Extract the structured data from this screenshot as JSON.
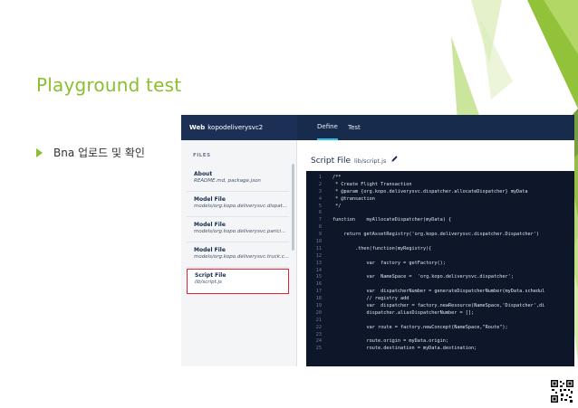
{
  "slide": {
    "title": "Playground test",
    "bullet": "Bna 업로드 및 확인"
  },
  "app": {
    "brand": "Web",
    "network": "kopodeliverysvc2",
    "tabs": [
      {
        "label": "Define",
        "active": true
      },
      {
        "label": "Test",
        "active": false
      }
    ],
    "sidebar": {
      "heading": "FILES",
      "items": [
        {
          "name": "About",
          "path": "README.md, package.json",
          "selected": false
        },
        {
          "name": "Model File",
          "path": "models/org.kopo.deliverysvc.dispat...",
          "selected": false
        },
        {
          "name": "Model File",
          "path": "models/org.kopo.deliverysvc.parici...",
          "selected": false
        },
        {
          "name": "Model File",
          "path": "models/org.kopo.deliverysvc.truck.c...",
          "selected": false
        },
        {
          "name": "Script File",
          "path": "lib/script.js",
          "selected": true
        }
      ]
    },
    "editor": {
      "label": "Script File",
      "path": "lib/script.js",
      "lines": [
        {
          "n": "1",
          "text": "/**",
          "cls": "tok-comment"
        },
        {
          "n": "2",
          "text": " * Create Flight Transaction",
          "cls": "tok-comment"
        },
        {
          "n": "3",
          "text": " * @param {org.kopo.deliverysvc.dispatcher.allocateDispatcher} myData",
          "cls": "tok-comment"
        },
        {
          "n": "4",
          "text": " * @transaction",
          "cls": "tok-comment"
        },
        {
          "n": "5",
          "text": " */",
          "cls": "tok-comment"
        },
        {
          "n": "6",
          "text": "",
          "cls": ""
        },
        {
          "n": "7",
          "text": "function    myAllocateDispatcher(myData) {",
          "cls": ""
        },
        {
          "n": "8",
          "text": "",
          "cls": ""
        },
        {
          "n": "9",
          "text": "    return getAssetRegistry('org.kopo.deliverysvc.dispatcher.Dispatcher')",
          "cls": ""
        },
        {
          "n": "10",
          "text": "",
          "cls": ""
        },
        {
          "n": "11",
          "text": "        .then(function(myRegistry){",
          "cls": ""
        },
        {
          "n": "12",
          "text": "",
          "cls": ""
        },
        {
          "n": "13",
          "text": "            var  factory = getFactory();",
          "cls": ""
        },
        {
          "n": "14",
          "text": "",
          "cls": ""
        },
        {
          "n": "15",
          "text": "            var  NameSpace =  'org.kopo.deliverysvc.dispatcher';",
          "cls": ""
        },
        {
          "n": "16",
          "text": "",
          "cls": ""
        },
        {
          "n": "17",
          "text": "            var  dispatcherNumber = generateDispatcherNumber(myData.schedul",
          "cls": ""
        },
        {
          "n": "18",
          "text": "            // registry add",
          "cls": "tok-comment"
        },
        {
          "n": "19",
          "text": "            var  dispatcher = factory.newResource(NameSpace,'Dispatcher',di",
          "cls": ""
        },
        {
          "n": "20",
          "text": "            dispatcher.aliasDispatcherNumber = [];",
          "cls": ""
        },
        {
          "n": "21",
          "text": "",
          "cls": ""
        },
        {
          "n": "22",
          "text": "            var route = factory.newConcept(NameSpace,\"Route\");",
          "cls": ""
        },
        {
          "n": "23",
          "text": "",
          "cls": ""
        },
        {
          "n": "24",
          "text": "            route.origin = myData.origin;",
          "cls": ""
        },
        {
          "n": "25",
          "text": "            route.destination = myData.destination;",
          "cls": ""
        }
      ]
    }
  },
  "colors": {
    "accent_green": "#8cbf2f",
    "app_header": "#172b4d",
    "code_bg": "#0e1629",
    "selected_border": "#e2243a"
  }
}
